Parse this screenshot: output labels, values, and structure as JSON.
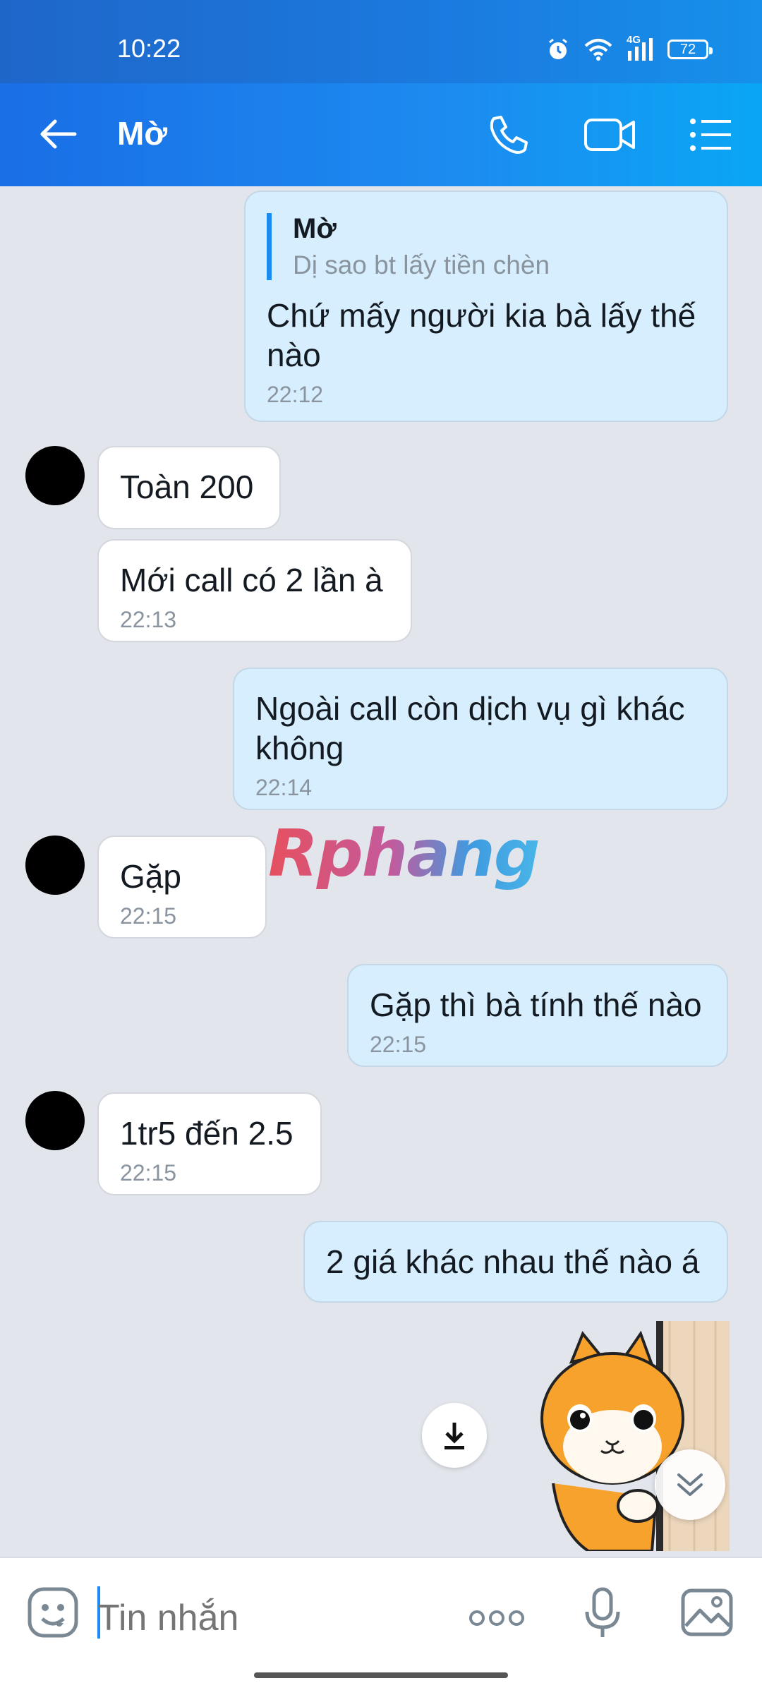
{
  "status_bar": {
    "time": "10:22",
    "network": "4G",
    "battery": "72"
  },
  "header": {
    "title": "Mờ"
  },
  "messages": [
    {
      "reply_name": "Mờ",
      "reply_text": "Dị sao bt lấy tiền chèn",
      "text": "Chứ mấy người kia bà lấy thế\nnào",
      "time": "22:12"
    },
    {
      "text": "Toàn 200"
    },
    {
      "text": "Mới call có 2 lần à",
      "time": "22:13"
    },
    {
      "text": "Ngoài call còn dịch vụ gì khác\nkhông",
      "time": "22:14"
    },
    {
      "text": "Gặp",
      "time": "22:15"
    },
    {
      "text": "Gặp thì bà tính thế nào",
      "time": "22:15"
    },
    {
      "text": "1tr5 đến 2.5",
      "time": "22:15"
    },
    {
      "text": "2 giá khác nhau thế nào á"
    }
  ],
  "watermark": "Rphang",
  "composer": {
    "placeholder": "Tin nhắn"
  },
  "colors": {
    "header": "#1a8cf0",
    "outgoing_bubble": "#d6eefe",
    "incoming_bubble": "#ffffff",
    "chat_background": "#e2e6ec"
  }
}
